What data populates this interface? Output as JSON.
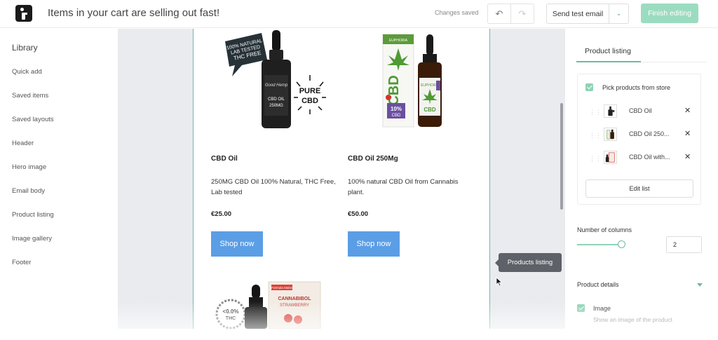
{
  "header": {
    "title": "Items in your cart are selling out fast!",
    "status": "Changes saved",
    "undo_icon": "↶",
    "redo_icon": "↷",
    "send_test_label": "Send test email",
    "send_test_caret": "⌄",
    "finish_label": "Finish editing",
    "accent_color": "#6ebaa5"
  },
  "library": {
    "title": "Library",
    "items": [
      {
        "label": "Quick add"
      },
      {
        "label": "Saved items"
      },
      {
        "label": "Saved layouts"
      },
      {
        "label": "Header"
      },
      {
        "label": "Hero image"
      },
      {
        "label": "Email body"
      },
      {
        "label": "Product listing"
      },
      {
        "label": "Image gallery"
      },
      {
        "label": "Footer"
      }
    ]
  },
  "canvas": {
    "products": [
      {
        "name": "CBD Oil",
        "description": "250MG CBD Oil 100% Natural, THC Free, Lab tested",
        "price": "€25.00",
        "button": "Shop now",
        "badge_text": "100% NATURAL LAB TESTED THC FREE",
        "badge2_text": "PURE CBD",
        "bottle_label": "CBD OIL 250MG",
        "bottle_brand": "Good Hemp"
      },
      {
        "name": "CBD Oil 250Mg",
        "description": "100% natural CBD Oil from Cannabis plant.",
        "price": "€50.00",
        "button": "Shop now",
        "box_text": "CBD",
        "box_brand": "EUPHORIA",
        "box_percent": "10%",
        "box_percent_label": "CBD"
      },
      {
        "badge_text": "<0.0% THC",
        "box_text": "CANNABIBOL STRAWBERRY",
        "box_brand": "Formula Swiss"
      }
    ],
    "tooltip": "Products listing",
    "button_color": "#5b9ee6"
  },
  "panel": {
    "tab": "Product listing",
    "pick_label": "Pick products from store",
    "products": [
      {
        "name": "CBD Oil",
        "remove": "✕"
      },
      {
        "name": "CBD Oil 250...",
        "remove": "✕"
      },
      {
        "name": "CBD Oil with...",
        "remove": "✕"
      }
    ],
    "edit_list": "Edit list",
    "columns_label": "Number of columns",
    "columns_value": "2",
    "details_label": "Product details",
    "image_label": "Image",
    "image_help": "Show an image of the product"
  }
}
